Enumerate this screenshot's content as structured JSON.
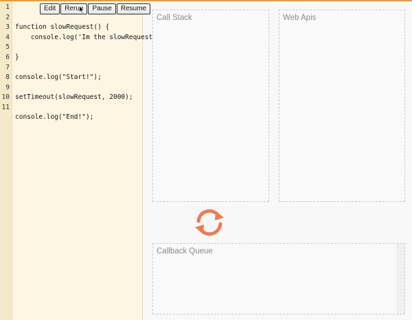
{
  "toolbar": {
    "edit": "Edit",
    "rerun": "Rerun",
    "pause": "Pause",
    "resume": "Resume"
  },
  "editor": {
    "lines": [
      {
        "n": "1",
        "code": ""
      },
      {
        "n": "2",
        "code": ""
      },
      {
        "n": "3",
        "code": "function slowRequest() {"
      },
      {
        "n": "4",
        "code": "    console.log('Im the slowRequest')"
      },
      {
        "n": "5",
        "code": ""
      },
      {
        "n": "6",
        "code": "}"
      },
      {
        "n": "7",
        "code": ""
      },
      {
        "n": "8",
        "code": "console.log(\"Start!\");"
      },
      {
        "n": "9",
        "code": ""
      },
      {
        "n": "10",
        "code": "setTimeout(slowRequest, 2000);"
      },
      {
        "n": "11",
        "code": ""
      },
      {
        "n": "",
        "code": "console.log(\"End!\");"
      }
    ]
  },
  "panels": {
    "call_stack": "Call Stack",
    "web_apis": "Web Apis",
    "callback_queue": "Callback Queue"
  },
  "icons": {
    "event_loop": "refresh-cycle-icon",
    "pointer": "mouse-pointer-icon"
  },
  "colors": {
    "accent": "#ef9b2c",
    "loop": "#ef7b52",
    "editor_bg": "#fdf6e3"
  }
}
